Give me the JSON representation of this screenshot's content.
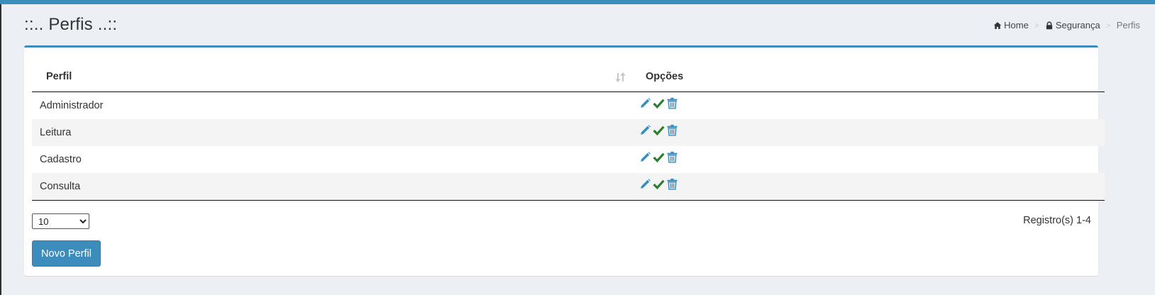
{
  "page": {
    "title": "::.. Perfis ..::"
  },
  "breadcrumb": {
    "items": [
      {
        "label": "Home",
        "icon": "home-icon"
      },
      {
        "label": "Segurança",
        "icon": "lock-icon"
      },
      {
        "label": "Perfis",
        "icon": ""
      }
    ],
    "separator": ">"
  },
  "table": {
    "headers": {
      "perfil": "Perfil",
      "opcoes": "Opções"
    },
    "rows": [
      {
        "name": "Administrador"
      },
      {
        "name": "Leitura"
      },
      {
        "name": "Cadastro"
      },
      {
        "name": "Consulta"
      }
    ],
    "option_icons": [
      "edit-pencil-icon",
      "check-icon",
      "trash-icon"
    ]
  },
  "pagination": {
    "page_size_options": [
      "10"
    ],
    "selected_page_size": "10",
    "records_info": "Registro(s) 1-4"
  },
  "actions": {
    "new_profile_label": "Novo Perfil"
  },
  "colors": {
    "accent": "#3c8dbc",
    "check": "#2e7d32",
    "icon_blue": "#3c8dbc",
    "content_bg": "#ecf0f5"
  }
}
